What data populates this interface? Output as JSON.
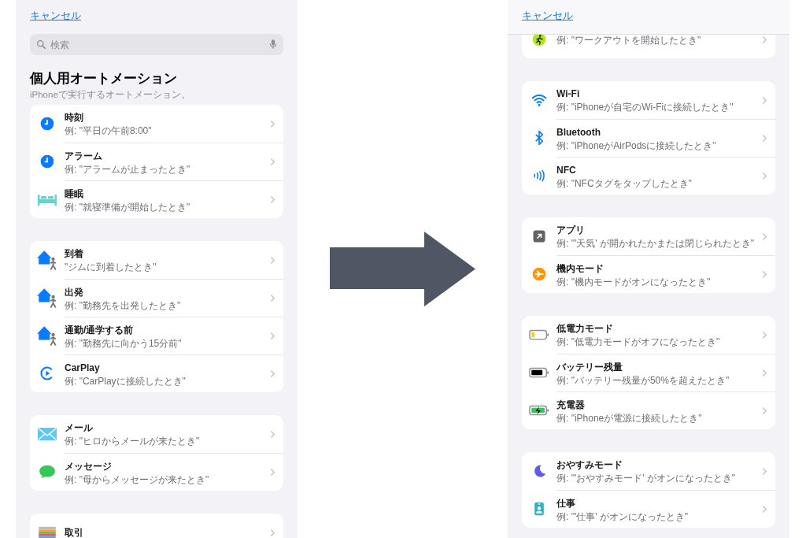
{
  "left": {
    "cancel": "キャンセル",
    "search": {
      "placeholder": "検索"
    },
    "title": "個人用オートメーション",
    "subtitle": "iPhoneで実行するオートメーション。",
    "groups": [
      {
        "rows": [
          {
            "kind": "clock",
            "title": "時刻",
            "example": "例: \"平日の午前8:00\""
          },
          {
            "kind": "clock",
            "title": "アラーム",
            "example": "例: \"アラームが止まったとき\""
          },
          {
            "kind": "bed",
            "title": "睡眠",
            "example": "例: \"就寝準備が開始したとき\""
          }
        ]
      },
      {
        "rows": [
          {
            "kind": "location",
            "title": "到着",
            "example": "\"ジムに到着したとき\""
          },
          {
            "kind": "location",
            "title": "出発",
            "example": "例: \"勤務先を出発したとき\""
          },
          {
            "kind": "location",
            "title": "通勤/通学する前",
            "example": "例: \"勤務先に向かう15分前\""
          },
          {
            "kind": "carplay",
            "title": "CarPlay",
            "example": "例: \"CarPlayに接続したとき\""
          }
        ]
      },
      {
        "rows": [
          {
            "kind": "mail",
            "title": "メール",
            "example": "例: \"ヒロからメールが来たとき\""
          },
          {
            "kind": "message",
            "title": "メッセージ",
            "example": "例: \"母からメッセージが来たとき\""
          }
        ]
      },
      {
        "rows": [
          {
            "kind": "wallet",
            "title": "取引"
          }
        ]
      }
    ]
  },
  "right": {
    "cancel": "キャンセル",
    "groups": [
      {
        "rows": [
          {
            "kind": "workout",
            "example": "例: \"ワークアウトを開始したとき\""
          }
        ]
      },
      {
        "rows": [
          {
            "kind": "wifi",
            "title": "Wi-Fi",
            "example": "例: \"iPhoneが自宅のWi-Fiに接続したとき\""
          },
          {
            "kind": "bluetooth",
            "title": "Bluetooth",
            "example": "例: \"iPhoneがAirPodsに接続したとき\""
          },
          {
            "kind": "nfc",
            "title": "NFC",
            "example": "例: \"NFCタグをタップしたとき\""
          }
        ]
      },
      {
        "rows": [
          {
            "kind": "app",
            "title": "アプリ",
            "example": "例: \"'天気' が開かれたかまたは閉じられたとき\""
          },
          {
            "kind": "airplane",
            "title": "機内モード",
            "example": "例: \"機内モードがオンになったとき\""
          }
        ]
      },
      {
        "rows": [
          {
            "kind": "battery-low",
            "title": "低電力モード",
            "example": "例: \"低電力モードがオフになったとき\""
          },
          {
            "kind": "battery",
            "title": "バッテリー残量",
            "example": "例: \"バッテリー残量が50%を超えたとき\""
          },
          {
            "kind": "charger",
            "title": "充電器",
            "example": "例: \"iPhoneが電源に接続したとき\""
          }
        ]
      },
      {
        "rows": [
          {
            "kind": "moon",
            "title": "おやすみモード",
            "example": "例: \"'おやすみモード' がオンになったとき\""
          },
          {
            "kind": "badge",
            "title": "仕事",
            "example": "例: \"'仕事' がオンになったとき\""
          }
        ]
      }
    ]
  }
}
